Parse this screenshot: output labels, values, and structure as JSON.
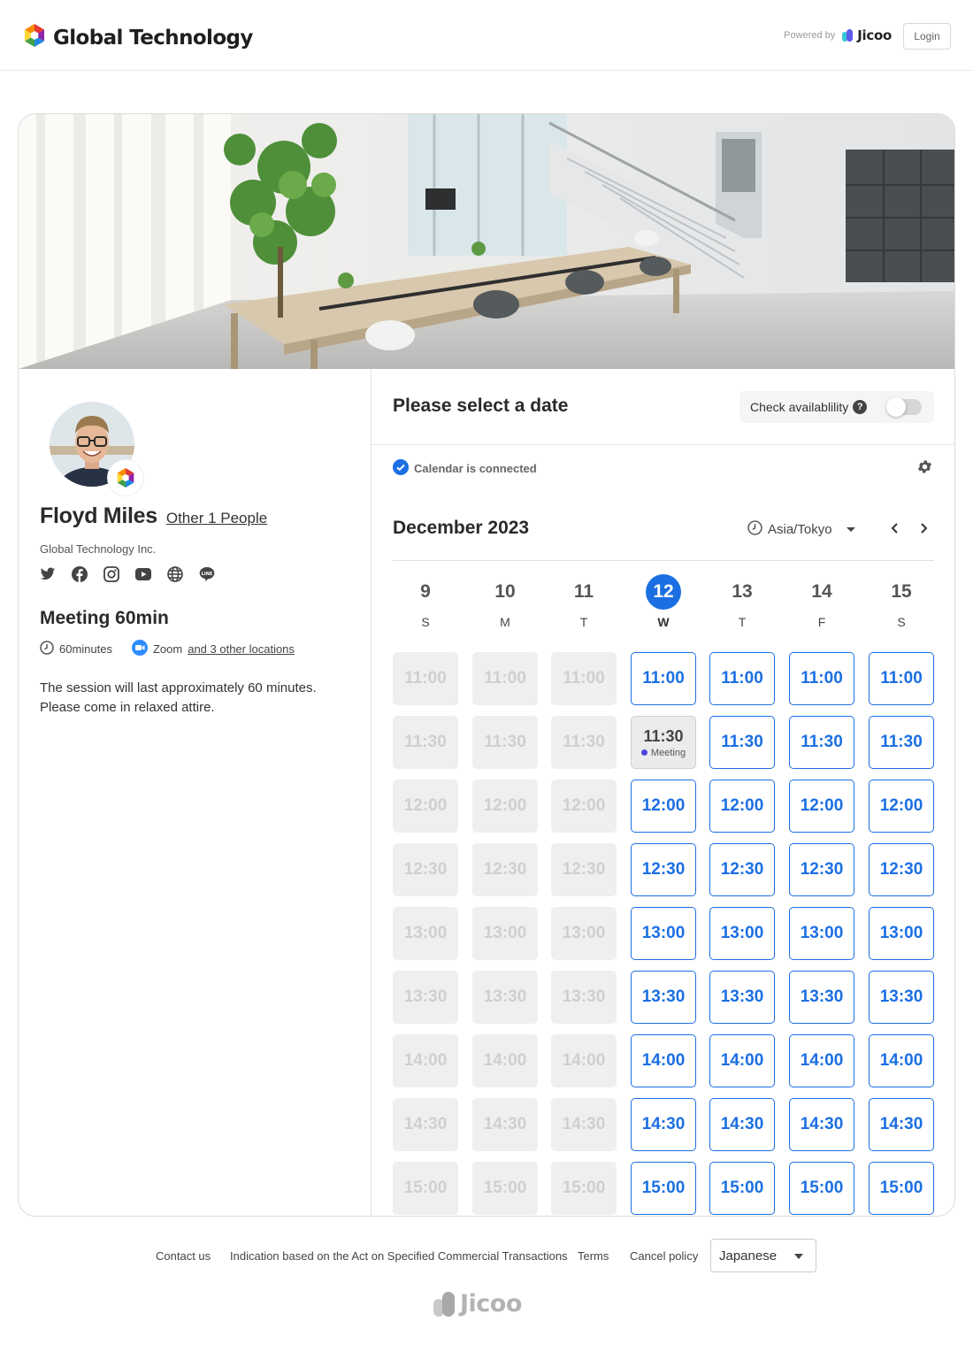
{
  "header": {
    "brand_name": "Global Technology",
    "powered_by": "Powered by",
    "jicoo_logo": "Jicoo",
    "login_label": "Login"
  },
  "host": {
    "name": "Floyd Miles",
    "other_people": "Other 1 People",
    "company": "Global Technology Inc.",
    "social_icons": [
      "twitter-icon",
      "facebook-icon",
      "instagram-icon",
      "youtube-icon",
      "globe-icon",
      "line-icon"
    ]
  },
  "meeting": {
    "title": "Meeting 60min",
    "duration": "60minutes",
    "location": "Zoom",
    "other_locations": "and 3 other locations",
    "description_line1": "The session will last approximately 60 minutes.",
    "description_line2": "Please come in relaxed attire."
  },
  "calendar": {
    "heading": "Please select a date",
    "check_availability": "Check availablility",
    "check_availability_enabled": false,
    "connected_label": "Calendar is connected",
    "month_label": "December 2023",
    "timezone": "Asia/Tokyo",
    "accent_color": "#1b6fe3",
    "days": [
      {
        "num": "9",
        "letter": "S",
        "today": false,
        "available": false
      },
      {
        "num": "10",
        "letter": "M",
        "today": false,
        "available": false
      },
      {
        "num": "11",
        "letter": "T",
        "today": false,
        "available": false
      },
      {
        "num": "12",
        "letter": "W",
        "today": true,
        "available": true
      },
      {
        "num": "13",
        "letter": "T",
        "today": false,
        "available": true
      },
      {
        "num": "14",
        "letter": "F",
        "today": false,
        "available": true
      },
      {
        "num": "15",
        "letter": "S",
        "today": false,
        "available": true
      }
    ],
    "times": [
      "11:00",
      "11:30",
      "12:00",
      "12:30",
      "13:00",
      "13:30",
      "14:00",
      "14:30",
      "15:00"
    ],
    "busy_slot": {
      "day": "12",
      "time": "11:30",
      "label": "Meeting",
      "dot_color": "#4a46e0"
    }
  },
  "footer": {
    "links": [
      "Contact us",
      "Indication based on the Act on Specified Commercial Transactions",
      "Terms",
      "Cancel policy"
    ],
    "language": "Japanese",
    "jicoo_logo": "Jicoo"
  }
}
